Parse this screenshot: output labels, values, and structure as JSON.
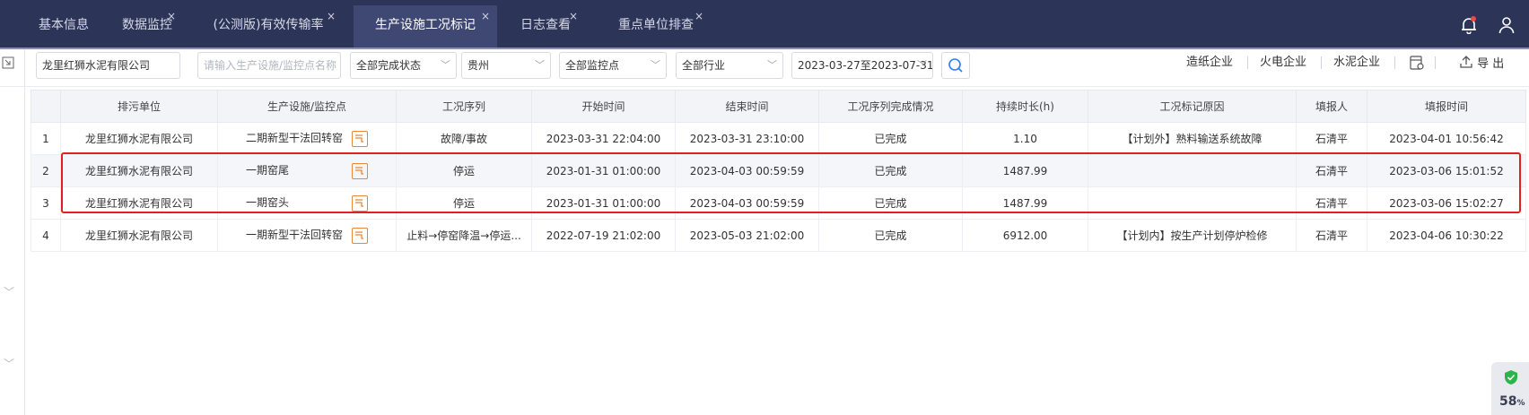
{
  "tabs": [
    {
      "label": "基本信息",
      "close": ""
    },
    {
      "label": "数据监控",
      "close": "×"
    },
    {
      "label": "(公测版)有效传输率",
      "close": "×"
    },
    {
      "label": "生产设施工况标记",
      "close": "×"
    },
    {
      "label": "日志查看",
      "close": "×"
    },
    {
      "label": "重点单位排查",
      "close": "×"
    }
  ],
  "filters": {
    "company_value": "龙里红狮水泥有限公司",
    "facility_placeholder": "请输入生产设施/监控点名称",
    "status": "全部完成状态",
    "region": "贵州",
    "monitor": "全部监控点",
    "industry": "全部行业",
    "date_range": "2023-03-27至2023-07-31"
  },
  "links": {
    "paper": "造纸企业",
    "power": "火电企业",
    "cement": "水泥企业",
    "export": "导 出"
  },
  "table": {
    "headers": [
      "",
      "排污单位",
      "生产设施/监控点",
      "工况序列",
      "开始时间",
      "结束时间",
      "工况序列完成情况",
      "持续时长(h)",
      "工况标记原因",
      "填报人",
      "填报时间"
    ],
    "rows": [
      {
        "no": "1",
        "unit": "龙里红狮水泥有限公司",
        "facility": "二期新型干法回转窑",
        "seq": "故障/事故",
        "start": "2023-03-31 22:04:00",
        "end": "2023-03-31 23:10:00",
        "status": "已完成",
        "hours": "1.10",
        "reason": "【计划外】熟料输送系统故障",
        "filler": "石清平",
        "filled": "2023-04-01 10:56:42"
      },
      {
        "no": "2",
        "unit": "龙里红狮水泥有限公司",
        "facility": "一期窑尾",
        "seq": "停运",
        "start": "2023-01-31 01:00:00",
        "end": "2023-04-03 00:59:59",
        "status": "已完成",
        "hours": "1487.99",
        "reason": "",
        "filler": "石清平",
        "filled": "2023-03-06 15:01:52"
      },
      {
        "no": "3",
        "unit": "龙里红狮水泥有限公司",
        "facility": "一期窑头",
        "seq": "停运",
        "start": "2023-01-31 01:00:00",
        "end": "2023-04-03 00:59:59",
        "status": "已完成",
        "hours": "1487.99",
        "reason": "",
        "filler": "石清平",
        "filled": "2023-03-06 15:02:27"
      },
      {
        "no": "4",
        "unit": "龙里红狮水泥有限公司",
        "facility": "一期新型干法回转窑",
        "seq": "止料→停窑降温→停运...",
        "start": "2022-07-19 21:02:00",
        "end": "2023-05-03 21:02:00",
        "status": "已完成",
        "hours": "6912.00",
        "reason": "【计划内】按生产计划停炉检修",
        "filler": "石清平",
        "filled": "2023-04-06 10:30:22"
      }
    ]
  },
  "security": {
    "percent": "58",
    "unit": "%"
  },
  "colors": {
    "header_bg": "#2c3458",
    "active_tab": "#3f4873",
    "status_green": "#2e9b43",
    "highlight_red": "#e02020",
    "icon_orange": "#e8883a"
  }
}
